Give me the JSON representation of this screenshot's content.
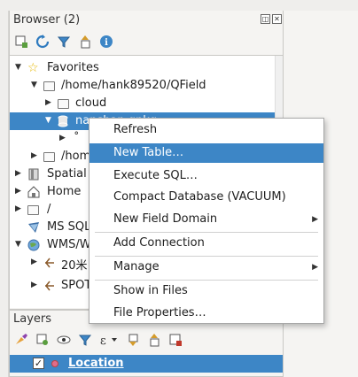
{
  "browser": {
    "title": "Browser (2)",
    "toolbar": [
      "add-layer-icon",
      "refresh-icon",
      "filter-icon",
      "collapse-icon",
      "info-icon"
    ],
    "tree": [
      {
        "label": "Favorites",
        "icon": "star-icon"
      },
      {
        "label": "/home/hank89520/QField",
        "icon": "folder-icon"
      },
      {
        "label": "cloud",
        "icon": "folder-icon"
      },
      {
        "label": "nanshan.gpkg",
        "icon": "database-icon"
      },
      {
        "label": "˚",
        "icon": "none"
      },
      {
        "label": "/hom",
        "icon": "folder-icon"
      },
      {
        "label": "Spatial",
        "icon": "bookmark-icon"
      },
      {
        "label": "Home",
        "icon": "home-icon"
      },
      {
        "label": "/",
        "icon": "folder-icon"
      },
      {
        "label": "MS SQL",
        "icon": "mssql-icon"
      },
      {
        "label": "WMS/W",
        "icon": "globe-icon"
      },
      {
        "label": "20米",
        "icon": "xyz-icon"
      },
      {
        "label": "SPOT",
        "icon": "xyz-icon"
      }
    ]
  },
  "context_menu": {
    "items": [
      {
        "label": "Refresh"
      },
      {
        "label": "New Table…"
      },
      {
        "label": "Execute SQL…"
      },
      {
        "label": "Compact Database (VACUUM)"
      },
      {
        "label": "New Field Domain"
      },
      {
        "label": "Add Connection"
      },
      {
        "label": "Manage"
      },
      {
        "label": "Show in Files"
      },
      {
        "label": "File Properties…"
      }
    ]
  },
  "layers": {
    "title": "Layers",
    "items": [
      {
        "label": "Location",
        "checked": "✓"
      }
    ]
  },
  "colors": {
    "selection": "#3d86c6",
    "menu_bg": "#ffffff",
    "panel_bg": "#f5f4f2"
  }
}
